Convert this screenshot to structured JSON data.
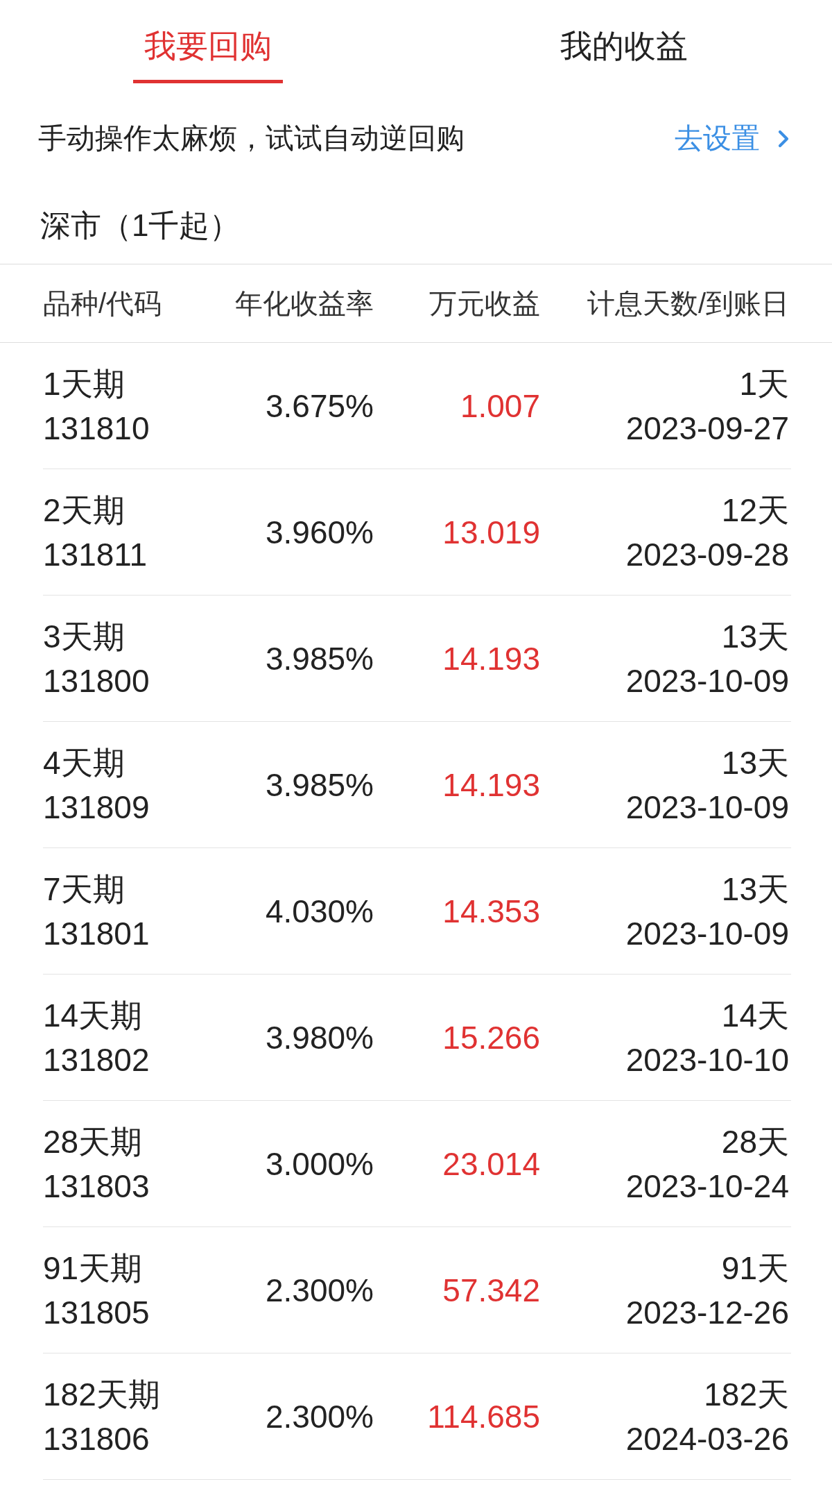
{
  "tabs": [
    {
      "label": "我要回购",
      "selected": true
    },
    {
      "label": "我的收益",
      "selected": false
    }
  ],
  "promo": {
    "text": "手动操作太麻烦，试试自动逆回购",
    "link": "去设置"
  },
  "market": "深市（1千起）",
  "table": {
    "columns": [
      "品种/代码",
      "年化收益率",
      "万元收益",
      "计息天数/到账日"
    ],
    "rows": [
      {
        "name": "1天期",
        "code": "131810",
        "rate": "3.675%",
        "income": "1.007",
        "days": "1天",
        "date": "2023-09-27"
      },
      {
        "name": "2天期",
        "code": "131811",
        "rate": "3.960%",
        "income": "13.019",
        "days": "12天",
        "date": "2023-09-28"
      },
      {
        "name": "3天期",
        "code": "131800",
        "rate": "3.985%",
        "income": "14.193",
        "days": "13天",
        "date": "2023-10-09"
      },
      {
        "name": "4天期",
        "code": "131809",
        "rate": "3.985%",
        "income": "14.193",
        "days": "13天",
        "date": "2023-10-09"
      },
      {
        "name": "7天期",
        "code": "131801",
        "rate": "4.030%",
        "income": "14.353",
        "days": "13天",
        "date": "2023-10-09"
      },
      {
        "name": "14天期",
        "code": "131802",
        "rate": "3.980%",
        "income": "15.266",
        "days": "14天",
        "date": "2023-10-10"
      },
      {
        "name": "28天期",
        "code": "131803",
        "rate": "3.000%",
        "income": "23.014",
        "days": "28天",
        "date": "2023-10-24"
      },
      {
        "name": "91天期",
        "code": "131805",
        "rate": "2.300%",
        "income": "57.342",
        "days": "91天",
        "date": "2023-12-26"
      },
      {
        "name": "182天期",
        "code": "131806",
        "rate": "2.300%",
        "income": "114.685",
        "days": "182天",
        "date": "2024-03-26"
      }
    ]
  }
}
